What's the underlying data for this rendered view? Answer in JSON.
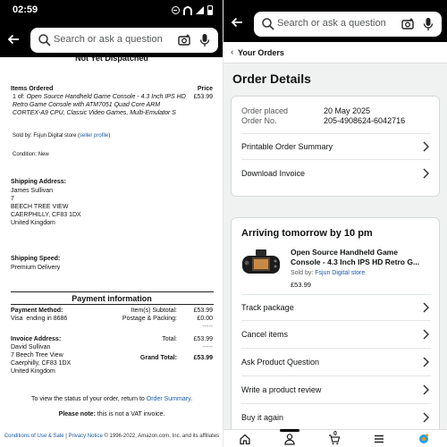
{
  "left": {
    "status": {
      "time": "02:59"
    },
    "search": {
      "placeholder": "Search or ask a question"
    },
    "invoice": {
      "status_heading": "Not Yet Dispatched",
      "items_ordered_label": "Items Ordered",
      "price_label": "Price",
      "item_qty": "1 of:",
      "item_title": "Open Source Handheld Game Console - 4.3 Inch IPS HD Retro Game Console with ATM7051 Quad Core ARM CORTEX-A9 CPU, Classic Video Games, Multi-Emulator S",
      "item_price": "£53.99",
      "sold_by_prefix": "Sold by: Fsjun Digital store",
      "seller_profile": "seller profile",
      "condition": "Condition: New",
      "shipping_address_label": "Shipping Address:",
      "shipping_address": [
        "James Sullivan",
        "7",
        "BEECH TREE VIEW",
        "CAERPHILLY, CF83 1DX",
        "United Kingdom"
      ],
      "shipping_speed_label": "Shipping Speed:",
      "shipping_speed": "Premium Delivery",
      "payment_info_heading": "Payment information",
      "payment_method_label": "Payment Method:",
      "payment_method": "Visa  ending in 8686",
      "item_subtotal_label": "Item(s) Subtotal:",
      "item_subtotal": "£53.99",
      "postage_label": "Postage & Packing:",
      "postage": "£0.00",
      "dashes": "-----",
      "invoice_address_label": "Invoice Address:",
      "invoice_address": [
        "David Sullivan",
        "7 Beech Tree View",
        "Caerphilly, CF83 1DX",
        "United Kingdom"
      ],
      "total_label": "Total:",
      "total": "£53.99",
      "grand_total_label": "Grand Total:",
      "grand_total": "£53.99",
      "view_status_text": "To view the status of your order, return to",
      "order_summary_link": "Order Summary",
      "note_label": "Please note:",
      "note_text": "this is not a VAT invoice.",
      "footer_conditions": "Conditions of Use & Sale",
      "footer_privacy": "Privacy Notice",
      "footer_copyright": "© 1996-2022, Amazon.com, Inc. and its affiliates"
    }
  },
  "right": {
    "search": {
      "placeholder": "Search or ask a question"
    },
    "breadcrumb": "Your Orders",
    "page_title": "Order Details",
    "order_placed_label": "Order placed",
    "order_placed": "20 May 2025",
    "order_no_label": "Order No.",
    "order_no": "205-4908624-6042716",
    "links": [
      "Printable Order Summary",
      "Download Invoice"
    ],
    "arriving": "Arriving tomorrow by 10 pm",
    "product": {
      "title": "Open Source Handheld Game Console - 4.3 Inch IPS HD Retro G...",
      "sold_by_label": "Sold by:",
      "seller": "Fsjun Digital store",
      "price": "£53.99"
    },
    "actions": [
      "Track package",
      "Cancel items",
      "Ask Product Question",
      "Write a product review",
      "Buy it again"
    ],
    "nav": {
      "cart_count": "0"
    }
  },
  "colors": {
    "link": "#1a5aa8",
    "header_bg": "#000000",
    "page_bg": "#f0f2f2"
  }
}
